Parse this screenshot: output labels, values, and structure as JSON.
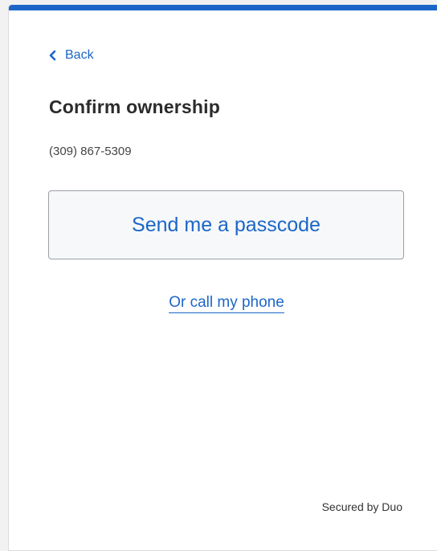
{
  "colors": {
    "accent": "#1c66c7",
    "heading": "#2b2b2b",
    "text": "#444444",
    "button_bg": "#f6f8fa",
    "button_border": "#9b9fa4"
  },
  "nav": {
    "back_label": "Back",
    "back_icon": "chevron-left-icon"
  },
  "main": {
    "title": "Confirm ownership",
    "phone_number": "(309) 867-5309",
    "send_passcode_label": "Send me a passcode",
    "call_phone_label": "Or call my phone"
  },
  "footer": {
    "secured_by": "Secured by Duo"
  }
}
